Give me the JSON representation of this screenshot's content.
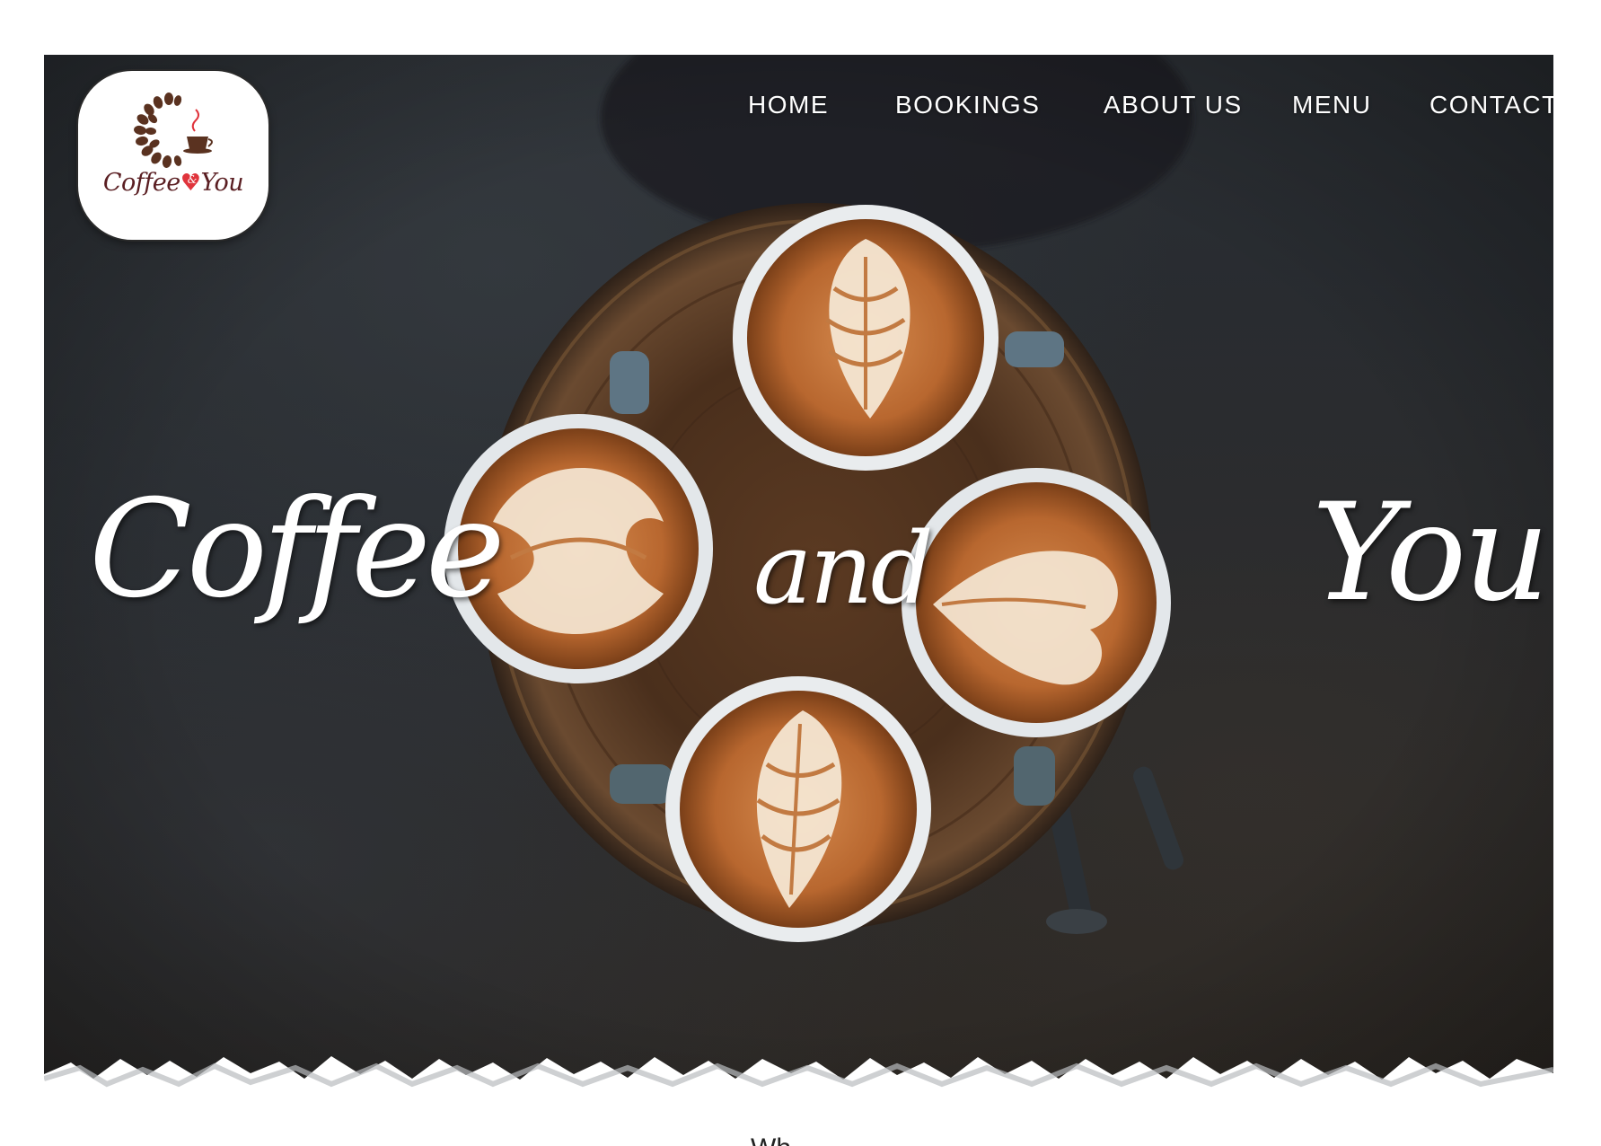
{
  "logo": {
    "text_left": "Coffee",
    "text_amp": "&",
    "text_right": "You",
    "heart_glyph": "♥",
    "icon": "coffee-bean-cup-logo",
    "colors": {
      "text": "#5a1e22",
      "heart": "#e0343c"
    }
  },
  "nav": {
    "items": [
      {
        "label": "HOME"
      },
      {
        "label": "BOOKINGS"
      },
      {
        "label": "ABOUT US"
      },
      {
        "label": "MENU"
      },
      {
        "label": "CONTACT"
      }
    ]
  },
  "hero": {
    "word_left": "Coffee",
    "word_middle": "and",
    "word_right": "You",
    "image": "four-latte-art-cups-on-wooden-stool"
  },
  "below": {
    "heading_partial": "Wh"
  }
}
